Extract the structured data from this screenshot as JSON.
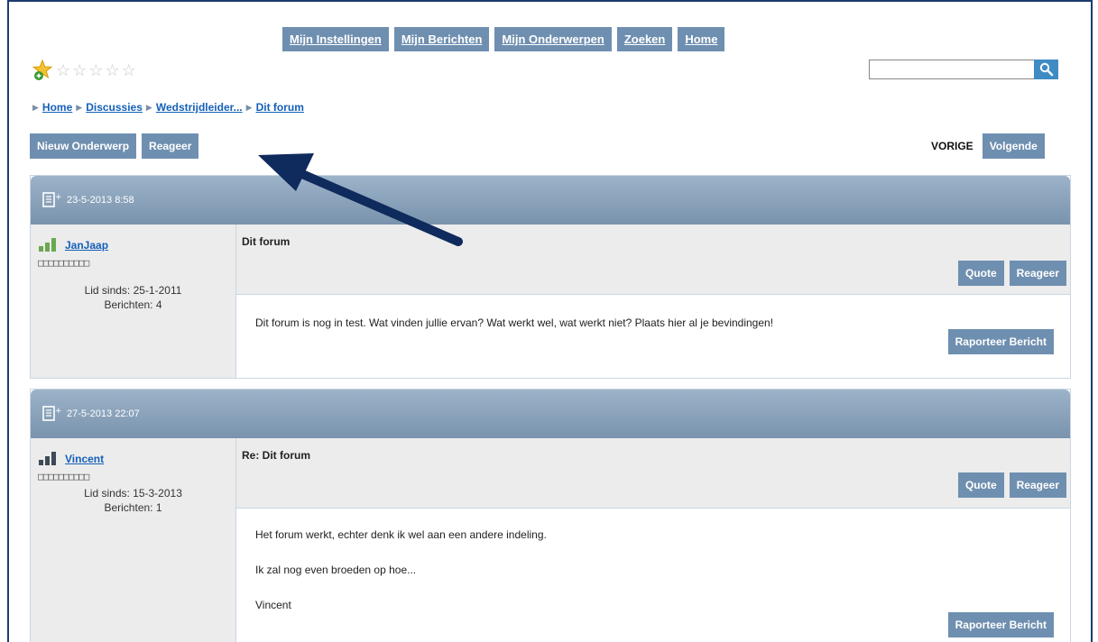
{
  "nav": {
    "items": [
      "Mijn Instellingen",
      "Mijn Berichten",
      "Mijn Onderwerpen",
      "Zoeken",
      "Home"
    ]
  },
  "breadcrumb": [
    "Home",
    "Discussies",
    "Wedstrijdleider...",
    "Dit forum"
  ],
  "actions": {
    "new_topic": "Nieuw Onderwerp",
    "reply": "Reageer",
    "previous": "VORIGE",
    "next": "Volgende"
  },
  "posts": [
    {
      "date": "23-5-2013 8:58",
      "user": "JanJaap",
      "rank": "□□□□□□□□□□",
      "member_since": "Lid sinds: 25-1-2011",
      "post_count": "Berichten: 4",
      "title": "Dit forum",
      "quote": "Quote",
      "reply": "Reageer",
      "lines": [
        "Dit forum is nog in test. Wat vinden jullie ervan? Wat werkt wel, wat werkt niet? Plaats hier al je bevindingen!"
      ],
      "report": "Raporteer Bericht"
    },
    {
      "date": "27-5-2013 22:07",
      "user": "Vincent",
      "rank": "□□□□□□□□□□",
      "member_since": "Lid sinds: 15-3-2013",
      "post_count": "Berichten: 1",
      "title": "Re: Dit forum",
      "quote": "Quote",
      "reply": "Reageer",
      "lines": [
        "Het forum werkt, echter denk ik wel aan een andere indeling.",
        "Ik zal nog even broeden op hoe...",
        "Vincent"
      ],
      "report": "Raporteer Bericht"
    }
  ],
  "colors": {
    "button": "#6f8fb0",
    "link": "#1560b8",
    "header_gradient_top": "#9cb3c9",
    "header_gradient_bottom": "#7993ad",
    "annotation_arrow": "#0f2a5c"
  }
}
